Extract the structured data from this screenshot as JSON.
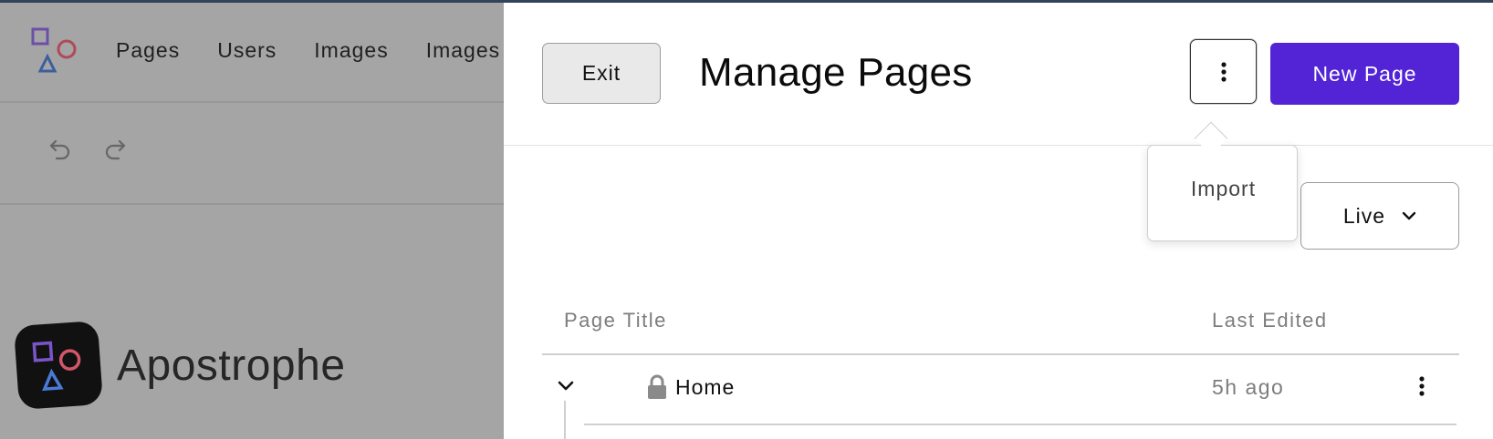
{
  "admin": {
    "nav": [
      "Pages",
      "Users",
      "Images",
      "Images"
    ],
    "brand_name": "Apostrophe"
  },
  "modal": {
    "exit_label": "Exit",
    "title": "Manage Pages",
    "new_page_label": "New Page",
    "more_menu": {
      "items": [
        "Import"
      ]
    },
    "mode_select": {
      "value": "Live"
    },
    "table": {
      "headers": {
        "title": "Page Title",
        "last_edited": "Last Edited"
      },
      "rows": [
        {
          "title": "Home",
          "last_edited": "5h ago",
          "locked": true,
          "expanded": true
        }
      ]
    }
  },
  "colors": {
    "primary": "#5224d6",
    "overlay": "#a5a5a5",
    "muted_text": "#7d7d7d"
  },
  "icons": [
    "apostrophe-logo-icon",
    "undo-icon",
    "redo-icon",
    "more-vertical-icon",
    "chevron-down-icon",
    "lock-icon"
  ]
}
